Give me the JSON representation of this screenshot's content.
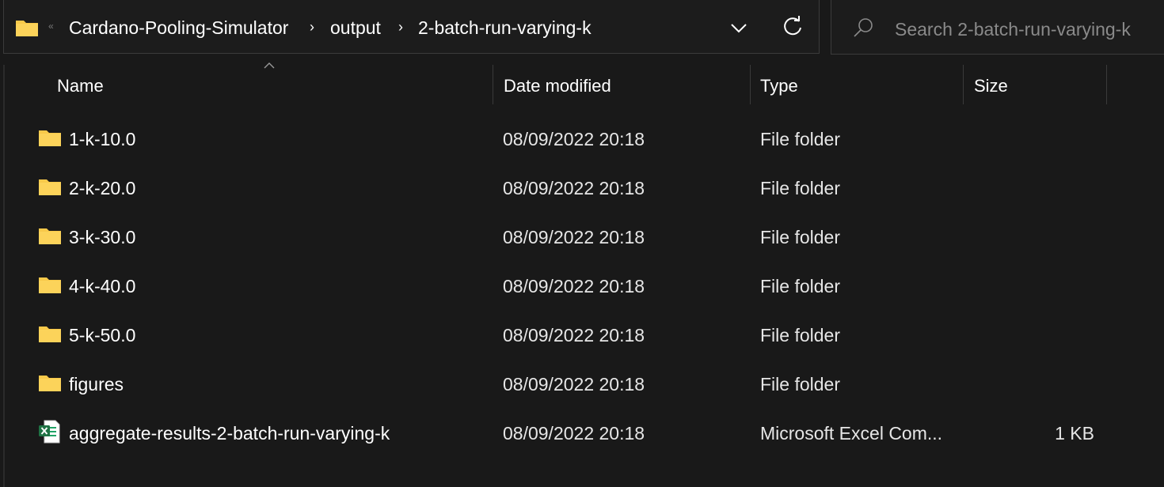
{
  "address_bar": {
    "overflow_glyph": "«",
    "crumbs": [
      "Cardano-Pooling-Simulator",
      "output",
      "2-batch-run-varying-k"
    ],
    "separator": "›"
  },
  "search": {
    "placeholder": "Search 2-batch-run-varying-k",
    "value": ""
  },
  "columns": {
    "name": "Name",
    "date": "Date modified",
    "type": "Type",
    "size": "Size"
  },
  "rows": [
    {
      "name": "1-k-10.0",
      "date": "08/09/2022 20:18",
      "type": "File folder",
      "size": "",
      "icon": "folder-icon"
    },
    {
      "name": "2-k-20.0",
      "date": "08/09/2022 20:18",
      "type": "File folder",
      "size": "",
      "icon": "folder-icon"
    },
    {
      "name": "3-k-30.0",
      "date": "08/09/2022 20:18",
      "type": "File folder",
      "size": "",
      "icon": "folder-icon"
    },
    {
      "name": "4-k-40.0",
      "date": "08/09/2022 20:18",
      "type": "File folder",
      "size": "",
      "icon": "folder-icon"
    },
    {
      "name": "5-k-50.0",
      "date": "08/09/2022 20:18",
      "type": "File folder",
      "size": "",
      "icon": "folder-icon"
    },
    {
      "name": "figures",
      "date": "08/09/2022 20:18",
      "type": "File folder",
      "size": "",
      "icon": "folder-icon"
    },
    {
      "name": "aggregate-results-2-batch-run-varying-k",
      "date": "08/09/2022 20:18",
      "type": "Microsoft Excel Com...",
      "size": "1 KB",
      "icon": "excel-file-icon"
    }
  ],
  "colors": {
    "background": "#191919",
    "folder": "#f8c94a",
    "excel": "#1f7244",
    "text": "#ffffff"
  }
}
